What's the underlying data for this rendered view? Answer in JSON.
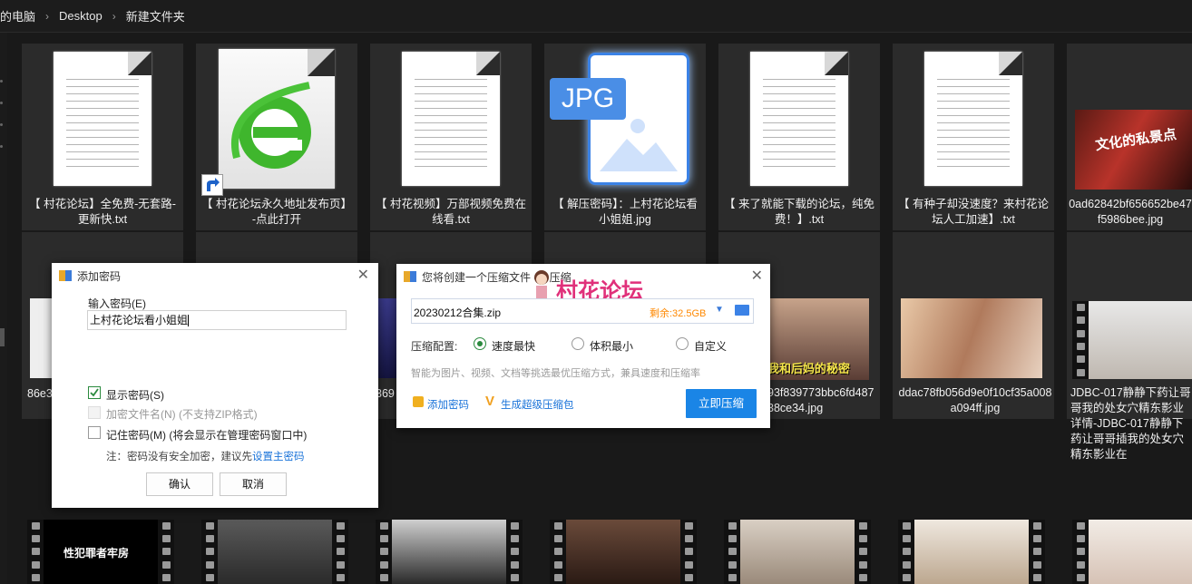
{
  "breadcrumb": {
    "items": [
      "的电脑",
      "Desktop",
      "新建文件夹"
    ]
  },
  "files_row1": [
    {
      "name": "【 村花论坛】全免费-无套路-更新快.txt",
      "icon": "text-file-icon"
    },
    {
      "name": "【 村花论坛永久地址发布页】-点此打开",
      "icon": "internet-explorer-icon"
    },
    {
      "name": "【 村花视频】万部视频免费在线看.txt",
      "icon": "text-file-icon"
    },
    {
      "name": "【 解压密码】：上村花论坛看小姐姐.jpg",
      "icon": "jpg-file-icon",
      "badge": "JPG"
    },
    {
      "name": "【 来了就能下载的论坛，纯免费！】.txt",
      "icon": "text-file-icon"
    },
    {
      "name": "【 有种子却没速度？来村花论坛人工加速】.txt",
      "icon": "text-file-icon"
    },
    {
      "name": "0ad62842bf656652be47f5986bee.jpg",
      "icon": "image-thumbnail"
    }
  ],
  "files_row2": [
    {
      "name": "86e3"
    },
    {
      "name": "369"
    },
    {
      "name": "93f839773bbc6fd48738ce34.jpg"
    },
    {
      "name": "ddac78fb056d9e0f10cf35a008a094ff.jpg"
    },
    {
      "name": "JDBC-017静静下药让哥哥我的处女穴精东影业详情-JDBC-017静静下药让哥哥插我的处女穴精东影业在"
    }
  ],
  "password_dialog": {
    "title": "添加密码",
    "input_label": "输入密码(E)",
    "input_value": "上村花论坛看小姐姐",
    "show_password": "显示密码(S)",
    "encrypt_filenames": "加密文件名(N) (不支持ZIP格式)",
    "remember_password": "记住密码(M) (将会显示在管理密码窗口中)",
    "note_prefix": "注：密码没有安全加密，建议先",
    "note_link": "设置主密码",
    "ok": "确认",
    "cancel": "取消",
    "show_password_checked": true
  },
  "zip_dialog": {
    "title": "您将创建一个压缩文件 - 2 压缩",
    "watermark": "村花论坛",
    "filename": "20230212合集.zip",
    "space": "剩余:32.5GB",
    "config_label": "压缩配置:",
    "options": [
      "速度最快",
      "体积最小",
      "自定义"
    ],
    "selected_option": "速度最快",
    "hint": "智能为图片、视频、文档等挑选最优压缩方式，兼具速度和压缩率",
    "add_password": "添加密码",
    "super_zip": "生成超级压缩包",
    "start": "立即压缩"
  },
  "image_texts": {
    "jpg_badge": "JPG",
    "thumb1": "文化的私景点",
    "thumb2": "我和后妈的秘密",
    "video1": "性犯罪者牢房"
  },
  "colors": {
    "accent": "#0a84e6",
    "orange": "#ff8800",
    "watermark": "#e0307a"
  }
}
